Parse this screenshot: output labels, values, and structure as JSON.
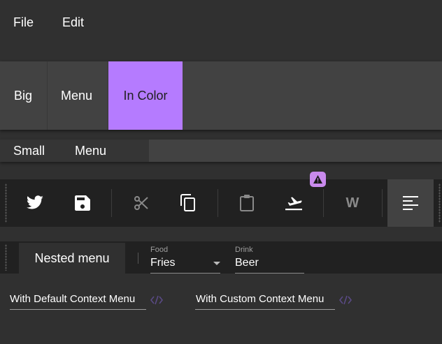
{
  "menubar": {
    "file_label": "File",
    "edit_label": "Edit"
  },
  "big_menubar": {
    "items": [
      "Big",
      "Menu",
      "In Color"
    ],
    "accent": "#b57bff"
  },
  "small_menubar": {
    "items": [
      "Small",
      "Menu"
    ]
  },
  "toolbar": {
    "buttons": [
      "twitter-icon",
      "save-icon",
      "cut-icon",
      "copy-icon",
      "paste-icon",
      "flight-takeoff-icon",
      "w-icon",
      "align-left-icon"
    ],
    "badge_icon": "warning-icon",
    "badge_color": "#c98aed",
    "w_label": "W"
  },
  "toolbar2": {
    "nested_label": "Nested menu",
    "food": {
      "label": "Food",
      "value": "Fries"
    },
    "drink": {
      "label": "Drink",
      "value": "Beer"
    }
  },
  "context": {
    "default_label": "With Default Context Menu",
    "custom_label": "With Custom Context Menu",
    "icon": "code-icon"
  }
}
